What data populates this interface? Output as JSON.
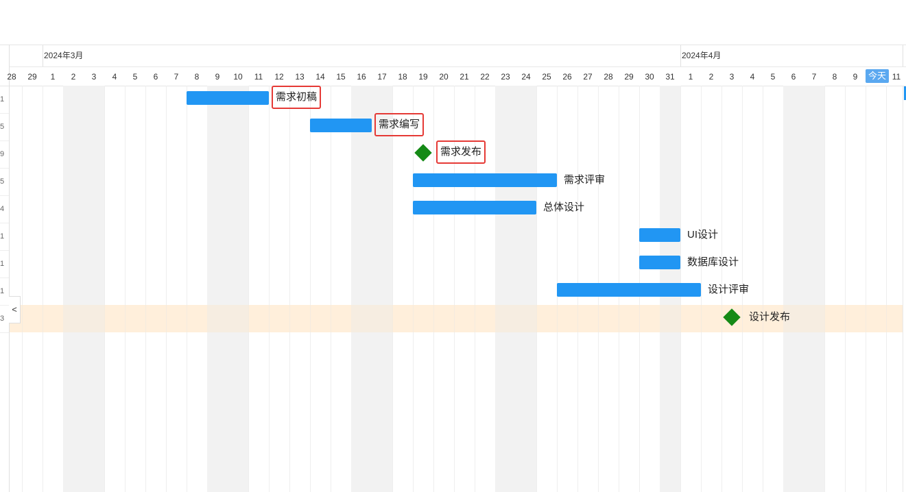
{
  "timeline": {
    "months": [
      {
        "label": "2024年3月"
      },
      {
        "label": "2024年4月"
      }
    ],
    "days": [
      "28",
      "29",
      "1",
      "2",
      "3",
      "4",
      "5",
      "6",
      "7",
      "8",
      "9",
      "10",
      "11",
      "12",
      "13",
      "14",
      "15",
      "16",
      "17",
      "18",
      "19",
      "20",
      "21",
      "22",
      "23",
      "24",
      "25",
      "26",
      "27",
      "28",
      "29",
      "30",
      "31",
      "1",
      "2",
      "3",
      "4",
      "5",
      "6",
      "7",
      "8",
      "9",
      "10",
      "11"
    ],
    "weekend_day_indices": [
      3,
      4,
      10,
      11,
      17,
      18,
      24,
      25,
      32,
      38,
      39
    ],
    "today_label": "今天"
  },
  "left_column_fragments": [
    "1",
    "5",
    "9",
    "5",
    "4",
    "1",
    "1",
    "1",
    "3"
  ],
  "collapse_button_label": "<",
  "tasks": [
    {
      "name": "需求初稿",
      "type": "bar",
      "start_day_index": 9,
      "end_day_index": 12,
      "highlighted": true
    },
    {
      "name": "需求编写",
      "type": "bar",
      "start_day_index": 15,
      "end_day_index": 17,
      "highlighted": true
    },
    {
      "name": "需求发布",
      "type": "milestone",
      "day_index": 20,
      "highlighted": true
    },
    {
      "name": "需求评审",
      "type": "bar",
      "start_day_index": 20,
      "end_day_index": 26,
      "highlighted": false
    },
    {
      "name": "总体设计",
      "type": "bar",
      "start_day_index": 20,
      "end_day_index": 25,
      "highlighted": false
    },
    {
      "name": "UI设计",
      "type": "bar",
      "start_day_index": 31,
      "end_day_index": 32,
      "highlighted": false
    },
    {
      "name": "数据库设计",
      "type": "bar",
      "start_day_index": 31,
      "end_day_index": 32,
      "highlighted": false
    },
    {
      "name": "设计评审",
      "type": "bar",
      "start_day_index": 27,
      "end_day_index": 33,
      "highlighted": false
    },
    {
      "name": "设计发布",
      "type": "milestone",
      "day_index": 35,
      "highlighted": false
    }
  ],
  "selected_row_index": 8,
  "colors": {
    "bar": "#2196f3",
    "milestone": "#158a16",
    "highlight_border": "#e53935",
    "weekend": "#f2f2f2",
    "selected_row": "#fff4e8",
    "today_badge": "#5aa8f0"
  }
}
